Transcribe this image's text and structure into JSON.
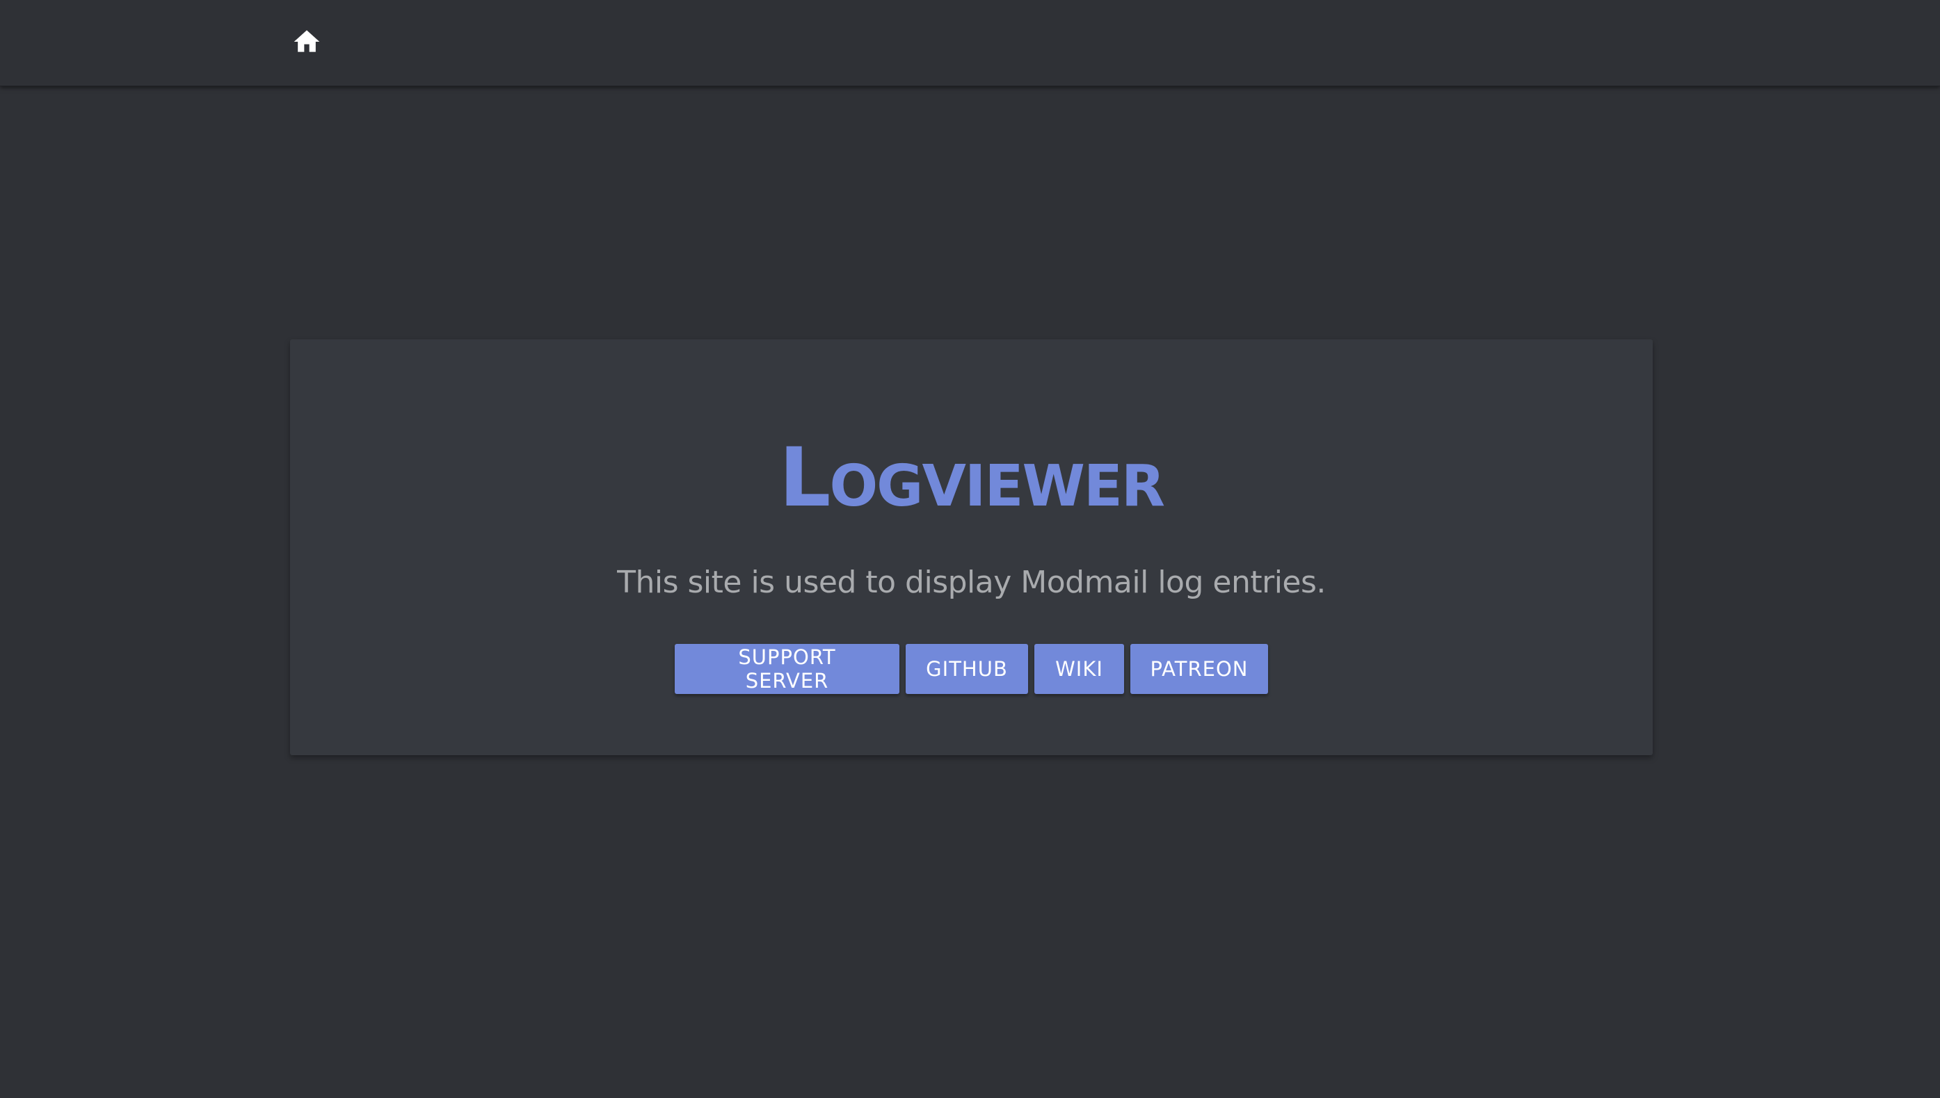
{
  "navbar": {
    "home_icon": "home-icon",
    "icon_color": "#ffffff"
  },
  "hero": {
    "title": "Logviewer",
    "tagline": "This site is used to display Modmail log entries.",
    "accent_color": "#7289da",
    "buttons": [
      {
        "label": "SUPPORT SERVER"
      },
      {
        "label": "GITHUB"
      },
      {
        "label": "WIKI"
      },
      {
        "label": "PATREON"
      }
    ]
  }
}
